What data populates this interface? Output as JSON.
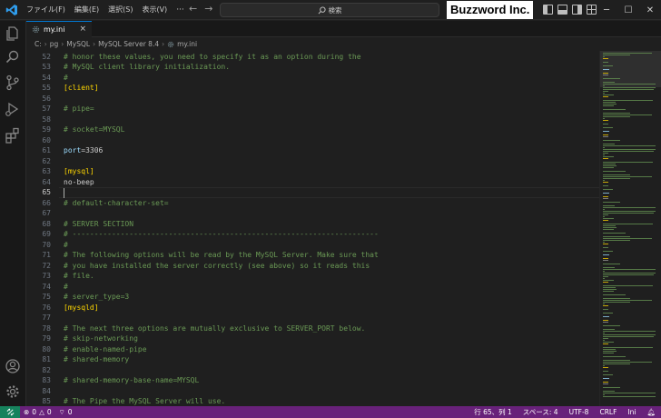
{
  "menu": [
    "ファイル(F)",
    "編集(E)",
    "選択(S)",
    "表示(V)"
  ],
  "menu_more": "···",
  "search": {
    "text": "検索"
  },
  "brand": "Buzzword Inc.",
  "tab": {
    "label": "my.ini",
    "close": "×"
  },
  "breadcrumb": [
    "C:",
    "pg",
    "MySQL",
    "MySQL Server 8.4",
    "my.ini"
  ],
  "editor": {
    "active_line": 65,
    "lines": [
      {
        "n": "52",
        "t": "# honor these values, you need to specify it as an option during the",
        "k": "comment"
      },
      {
        "n": "53",
        "t": "# MySQL client library initialization.",
        "k": "comment"
      },
      {
        "n": "54",
        "t": "#",
        "k": "comment"
      },
      {
        "n": "55",
        "t": "[client]",
        "k": "section"
      },
      {
        "n": "56",
        "t": "",
        "k": "plain"
      },
      {
        "n": "57",
        "t": "# pipe=",
        "k": "comment"
      },
      {
        "n": "58",
        "t": "",
        "k": "plain"
      },
      {
        "n": "59",
        "t": "# socket=MYSQL",
        "k": "comment"
      },
      {
        "n": "60",
        "t": "",
        "k": "plain"
      },
      {
        "n": "61",
        "t": "port=3306",
        "k": "keyval",
        "key": "port",
        "val": "=3306"
      },
      {
        "n": "62",
        "t": "",
        "k": "plain"
      },
      {
        "n": "63",
        "t": "[mysql]",
        "k": "section"
      },
      {
        "n": "64",
        "t": "no-beep",
        "k": "plain"
      },
      {
        "n": "65",
        "t": "",
        "k": "plain"
      },
      {
        "n": "66",
        "t": "# default-character-set=",
        "k": "comment"
      },
      {
        "n": "67",
        "t": "",
        "k": "plain"
      },
      {
        "n": "68",
        "t": "# SERVER SECTION",
        "k": "comment"
      },
      {
        "n": "69",
        "t": "# ----------------------------------------------------------------------",
        "k": "comment"
      },
      {
        "n": "70",
        "t": "#",
        "k": "comment"
      },
      {
        "n": "71",
        "t": "# The following options will be read by the MySQL Server. Make sure that",
        "k": "comment"
      },
      {
        "n": "72",
        "t": "# you have installed the server correctly (see above) so it reads this",
        "k": "comment"
      },
      {
        "n": "73",
        "t": "# file.",
        "k": "comment"
      },
      {
        "n": "74",
        "t": "#",
        "k": "comment"
      },
      {
        "n": "75",
        "t": "# server_type=3",
        "k": "comment"
      },
      {
        "n": "76",
        "t": "[mysqld]",
        "k": "section"
      },
      {
        "n": "77",
        "t": "",
        "k": "plain"
      },
      {
        "n": "78",
        "t": "# The next three options are mutually exclusive to SERVER_PORT below.",
        "k": "comment"
      },
      {
        "n": "79",
        "t": "# skip-networking",
        "k": "comment"
      },
      {
        "n": "80",
        "t": "# enable-named-pipe",
        "k": "comment"
      },
      {
        "n": "81",
        "t": "# shared-memory",
        "k": "comment"
      },
      {
        "n": "82",
        "t": "",
        "k": "plain"
      },
      {
        "n": "83",
        "t": "# shared-memory-base-name=MYSQL",
        "k": "comment"
      },
      {
        "n": "84",
        "t": "",
        "k": "plain"
      },
      {
        "n": "85",
        "t": "# The Pipe the MySQL Server will use.",
        "k": "comment"
      }
    ]
  },
  "status": {
    "errors": "0",
    "warnings": "0",
    "ports": "0",
    "position": "行 65、列 1",
    "spaces": "スペース: 4",
    "encoding": "UTF-8",
    "eol": "CRLF",
    "language": "Ini"
  },
  "colors": {
    "accent": "#0078d4",
    "statusbar": "#68217a",
    "remote": "#16825d",
    "comment": "#6a9955",
    "section": "#ffd700",
    "key": "#9cdcfe"
  }
}
